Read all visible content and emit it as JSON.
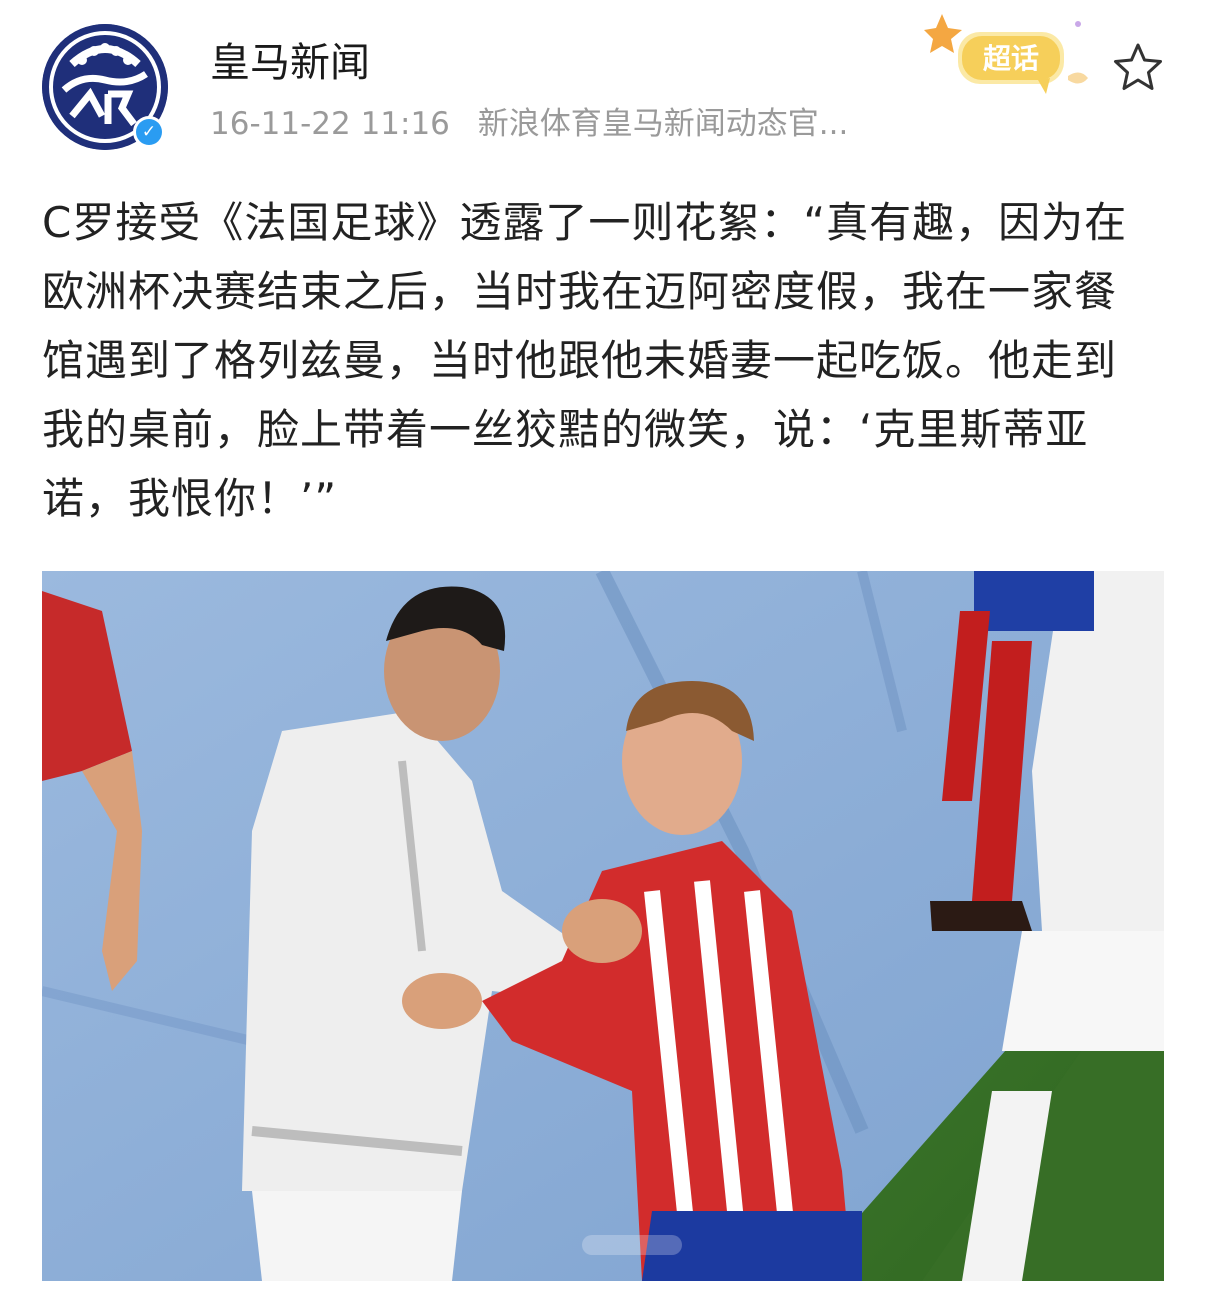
{
  "post": {
    "account_name": "皇马新闻",
    "timestamp": "16-11-22 11:16",
    "source": "新浪体育皇马新闻动态官...",
    "super_topic_badge": "超话",
    "text": "C罗接受《法国足球》透露了一则花絮：“真有趣，因为在欧洲杯决赛结束之后，当时我在迈阿密度假，我在一家餐馆遇到了格列兹曼，当时他跟他未婚妻一起吃饭。他走到我的桌前，脸上带着一丝狡黠的微笑，说：‘克里斯蒂亚诺，我恨你！’”"
  },
  "colors": {
    "avatar_blue": "#1f2f7a",
    "verified_blue": "#2a9cf2",
    "badge_yellow": "#f6cf5a",
    "meta_gray": "#9a9a9a"
  },
  "icons": {
    "verified": "verified-icon",
    "favorite": "star-icon",
    "supertopic": "supertopic-badge-icon"
  }
}
